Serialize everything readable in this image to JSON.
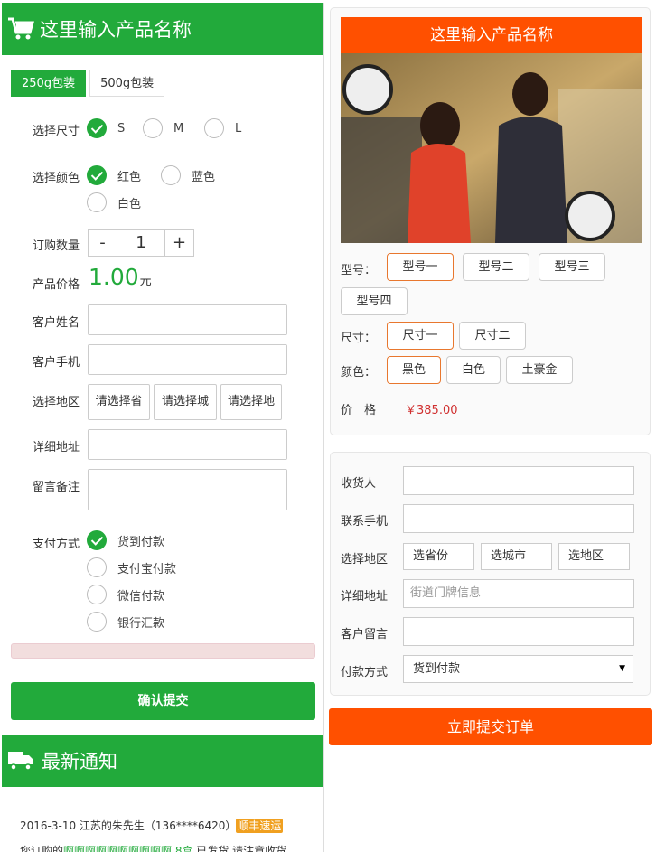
{
  "left": {
    "title": "这里输入产品名称",
    "packages": [
      "250g包装",
      "500g包装"
    ],
    "size": {
      "label": "选择尺寸",
      "options": [
        "S",
        "M",
        "L"
      ],
      "selected": 0
    },
    "color": {
      "label": "选择颜色",
      "options": [
        "红色",
        "蓝色",
        "白色"
      ],
      "selected": 0
    },
    "quantity": {
      "label": "订购数量",
      "minus": "-",
      "value": "1",
      "plus": "+"
    },
    "price": {
      "label": "产品价格",
      "value": "1.00",
      "unit": "元"
    },
    "name_label": "客户姓名",
    "phone_label": "客户手机",
    "region": {
      "label": "选择地区",
      "province": "请选择省",
      "city": "请选择城",
      "district": "请选择地"
    },
    "address_label": "详细地址",
    "note_label": "留言备注",
    "payment": {
      "label": "支付方式",
      "options": [
        "货到付款",
        "支付宝付款",
        "微信付款",
        "银行汇款"
      ],
      "selected": 0
    },
    "submit": "确认提交",
    "notice_title": "最新通知",
    "notice": {
      "line1_text": "2016-3-10 江苏的朱先生（136****6420）",
      "line1_tag": "顺丰速运",
      "line2_prefix": "您订购的",
      "line2_link": "啊啊啊啊啊啊啊啊啊啊 8盒",
      "line2_suffix": " 已发货,请注意收货"
    }
  },
  "right": {
    "title": "这里输入产品名称",
    "model": {
      "label": "型号：",
      "options": [
        "型号一",
        "型号二",
        "型号三",
        "型号四"
      ],
      "selected": 0
    },
    "size": {
      "label": "尺寸：",
      "options": [
        "尺寸一",
        "尺寸二"
      ],
      "selected": 0
    },
    "color": {
      "label": "颜色：",
      "options": [
        "黑色",
        "白色",
        "土豪金"
      ],
      "selected": 0
    },
    "price": {
      "label": "价　格",
      "value": "￥385.00"
    },
    "form": {
      "receiver_label": "收货人",
      "phone_label": "联系手机",
      "region_label": "选择地区",
      "province": "选省份",
      "city": "选城市",
      "district": "选地区",
      "address_label": "详细地址",
      "address_placeholder": "街道门牌信息",
      "message_label": "客户留言",
      "pay_label": "付款方式",
      "pay_value": "货到付款"
    },
    "submit": "立即提交订单"
  },
  "colors": {
    "green": "#22aa3b",
    "orange": "#ff5000",
    "price_red": "#d03030"
  }
}
